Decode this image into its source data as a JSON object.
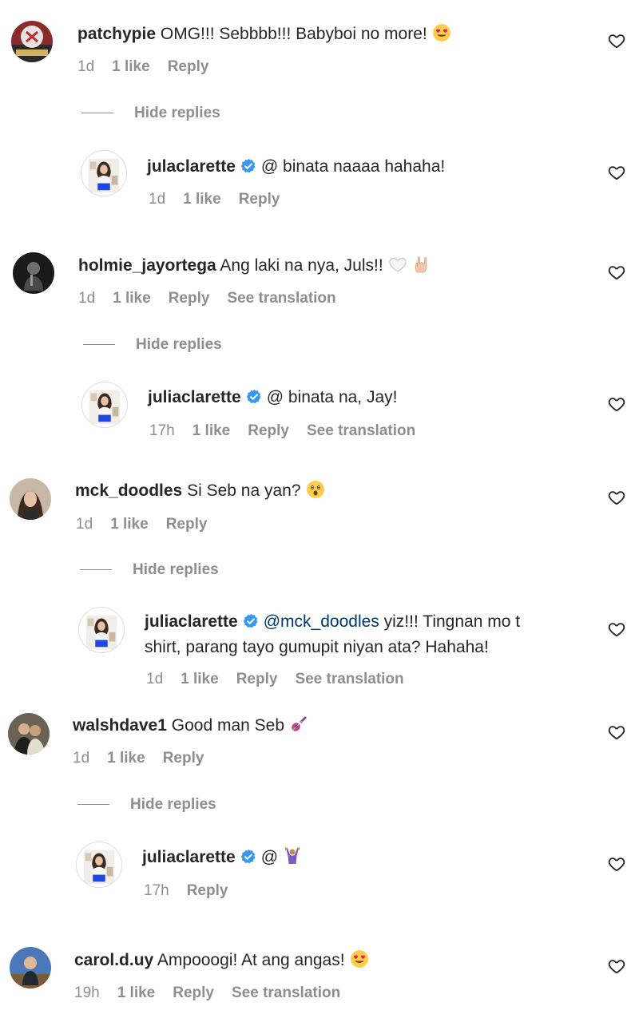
{
  "threads": [
    {
      "comment": {
        "username": "patchypie",
        "text": "OMG!!! Sebbbb!!! Babyboi no more!",
        "emoji": "smiling-face-with-heart-eyes-emoji",
        "time": "1d",
        "likes": "1 like",
        "reply_label": "Reply"
      },
      "hide_replies": "Hide replies",
      "reply": {
        "username": "julaclarette",
        "text": "@ binata naaaa hahaha!",
        "time": "1d",
        "likes": "1 like",
        "reply_label": "Reply"
      }
    },
    {
      "comment": {
        "username": "holmie_jayortega",
        "text": "Ang laki na nya, Juls!!",
        "emoji": "white-heart-and-rock-hand-emoji",
        "time": "1d",
        "likes": "1 like",
        "reply_label": "Reply",
        "translation": "See translation"
      },
      "hide_replies": "Hide replies",
      "reply": {
        "username": "juliaclarette",
        "text": "@ binata na, Jay!",
        "time": "17h",
        "likes": "1 like",
        "reply_label": "Reply",
        "translation": "See translation"
      }
    },
    {
      "comment": {
        "username": "mck_doodles",
        "text": "Si Seb na yan?",
        "emoji": "astonished-face-emoji",
        "time": "1d",
        "likes": "1 like",
        "reply_label": "Reply"
      },
      "hide_replies": "Hide replies",
      "reply": {
        "username": "juliaclarette",
        "mention": "@mck_doodles",
        "text_line1": "yiz!!! Tingnan mo t",
        "text_line2": "shirt, parang tayo gumupit niyan ata? Hahaha!",
        "time": "1d",
        "likes": "1 like",
        "reply_label": "Reply",
        "translation": "See translation"
      }
    },
    {
      "comment": {
        "username": "walshdave1",
        "text": "Good man Seb",
        "emoji": "guitar-emoji",
        "time": "1d",
        "likes": "1 like",
        "reply_label": "Reply"
      },
      "hide_replies": "Hide replies",
      "reply": {
        "username": "juliaclarette",
        "text": "@",
        "emoji": "person-raising-hands-emoji",
        "time": "17h",
        "reply_label": "Reply"
      }
    },
    {
      "comment": {
        "username": "carol.d.uy",
        "text": "Ampooogi! At ang angas!",
        "emoji": "smiling-face-with-heart-eyes-emoji",
        "time": "19h",
        "likes": "1 like",
        "reply_label": "Reply",
        "translation": "See translation"
      }
    }
  ],
  "icons": {
    "like": "heart-outline-icon",
    "verified": "verified-badge-icon"
  },
  "colors": {
    "text": "#262626",
    "secondary": "#8e8e8e",
    "verified": "#3897f0",
    "mention": "#00376b"
  }
}
